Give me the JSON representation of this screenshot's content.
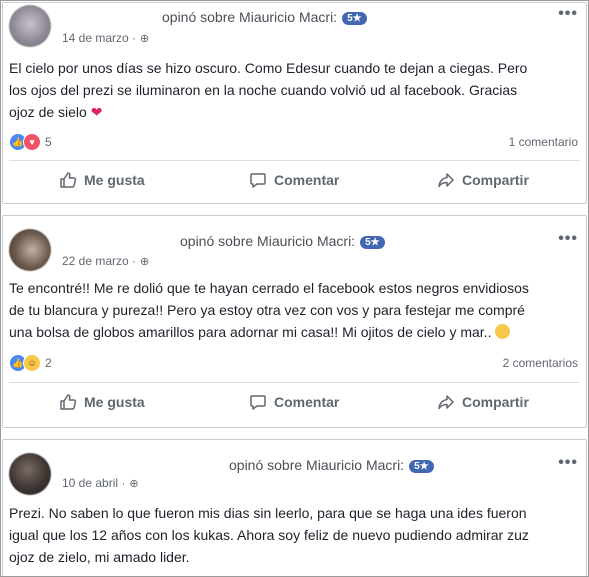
{
  "posts": [
    {
      "author_label": "opinó sobre Miauricio Macri:",
      "badge": "5★",
      "date": "14 de marzo",
      "text": "El cielo por unos días se hizo oscuro. Como Edesur cuando te dejan a ciegas. Pero\nlos ojos del prezi se iluminaron en la noche cuando volvió ud al facebook. Gracias\nojoz de sielo",
      "reaction_count": "5",
      "comments": "1 comentario",
      "actions": {
        "like": "Me gusta",
        "comment": "Comentar",
        "share": "Compartir"
      }
    },
    {
      "author_label": "opinó sobre Miauricio Macri:",
      "badge": "5★",
      "date": "22 de marzo",
      "text": "Te encontré!! Me re dolió que te hayan cerrado el facebook estos negros envidiosos\nde tu blancura y pureza!! Pero ya estoy otra vez con vos y para festejar me compré\nuna bolsa de globos amarillos para adornar mi casa!! Mi ojitos de cielo y mar..",
      "reaction_count": "2",
      "comments": "2 comentarios",
      "actions": {
        "like": "Me gusta",
        "comment": "Comentar",
        "share": "Compartir"
      }
    },
    {
      "author_label": "opinó sobre Miauricio Macri:",
      "badge": "5★",
      "date": "10 de abril",
      "text": "Prezi. No saben lo que fueron mis dias sin leerlo, para que se haga una ides fueron\nigual que los 12 años con los kukas. Ahora soy feliz de nuevo pudiendo admirar zuz\nojoz de zielo, mi amado lider."
    }
  ],
  "icons": {
    "more": "more-options-icon",
    "globe": "globe-icon",
    "like": "thumbs-up-icon",
    "comment": "comment-bubble-icon",
    "share": "share-arrow-icon"
  },
  "colors": {
    "badge": "#4267b2",
    "like_reaction": "#4a89f3",
    "love_reaction": "#f25268",
    "haha_reaction": "#f7c84a"
  }
}
